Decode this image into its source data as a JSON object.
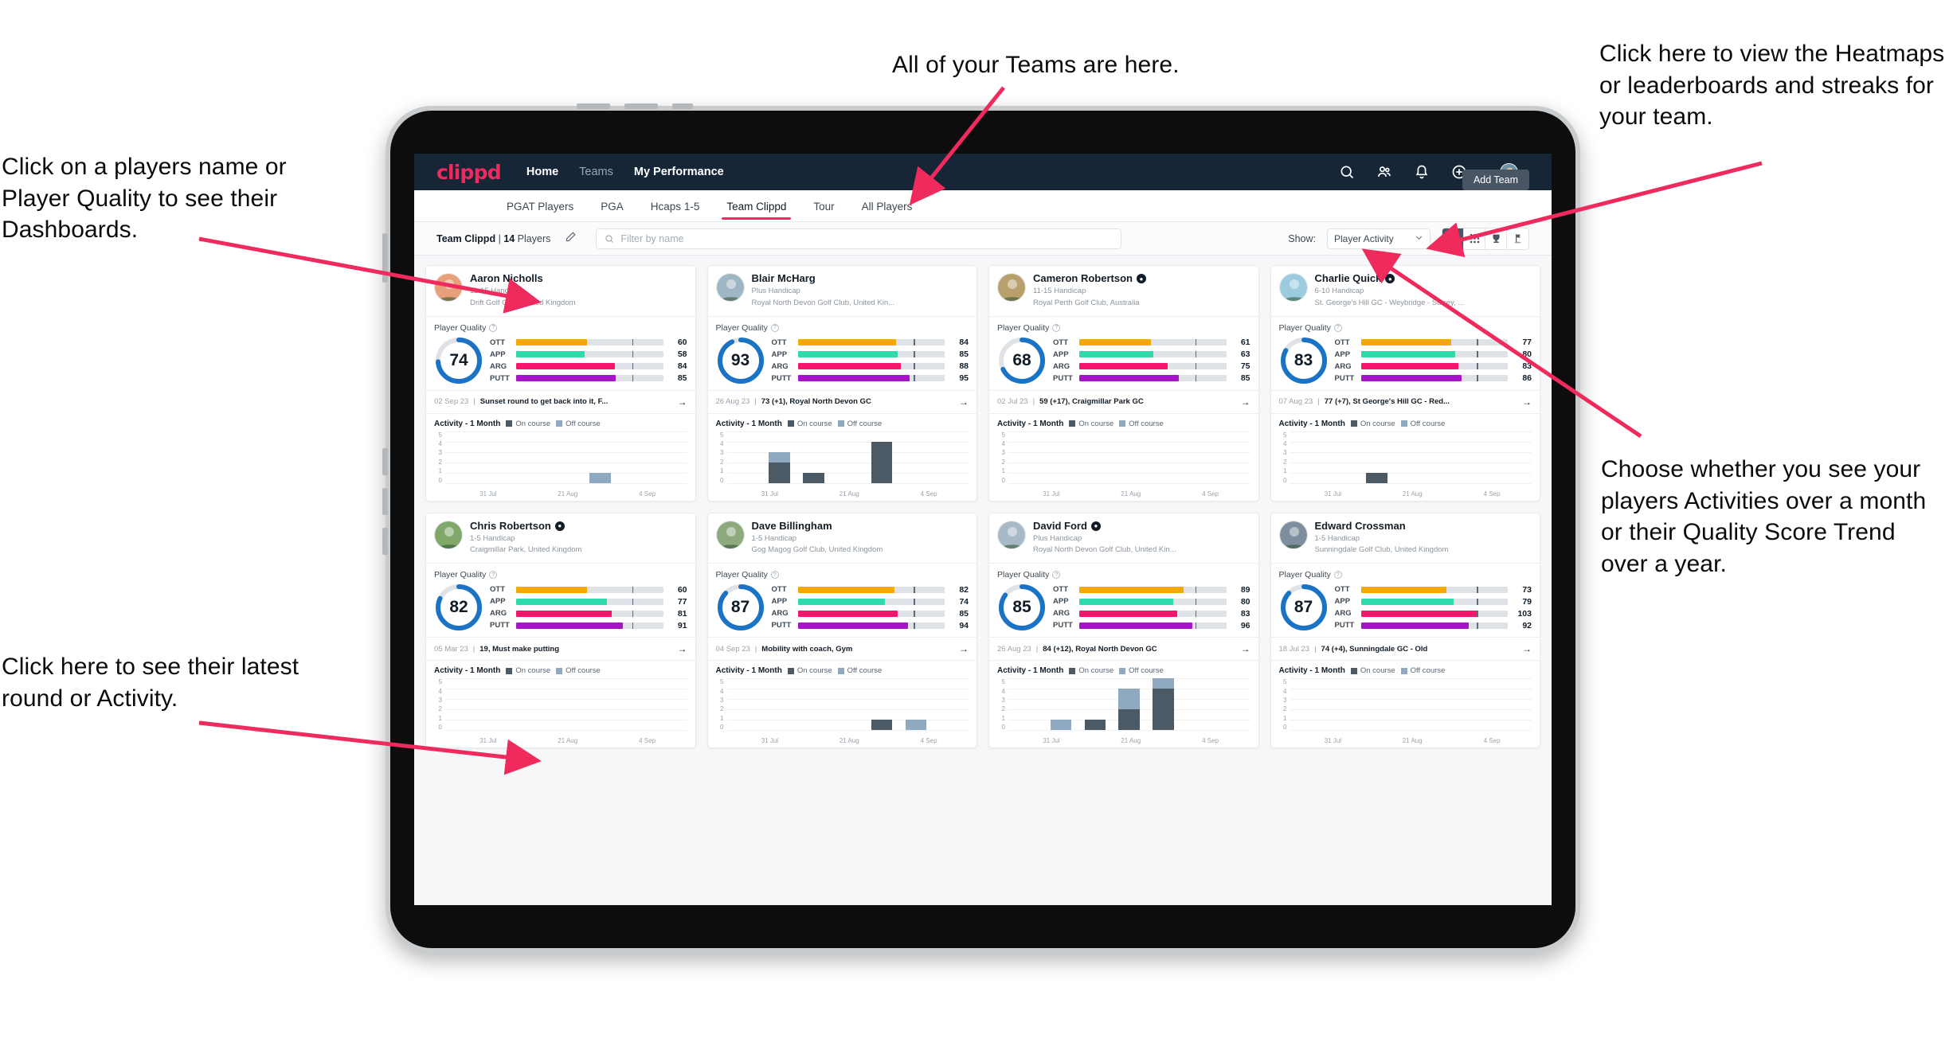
{
  "annotations": [
    {
      "id": "players-name",
      "text": "Click on a players name or Player Quality to see their Dashboards."
    },
    {
      "id": "teams",
      "text": "All of your Teams are here."
    },
    {
      "id": "heatmaps",
      "text": "Click here to view the Heatmaps or leaderboards and streaks for your team."
    },
    {
      "id": "activity-toggle",
      "text": "Choose whether you see your players Activities over a month or their Quality Score Trend over a year."
    },
    {
      "id": "latest-round",
      "text": "Click here to see their latest round or Activity."
    }
  ],
  "navbar": {
    "brand": "clippd",
    "links": [
      {
        "label": "Home",
        "active": true
      },
      {
        "label": "Teams",
        "active": false
      },
      {
        "label": "My Performance",
        "active": true
      }
    ],
    "icons": [
      "search-icon",
      "people-icon",
      "bell-icon",
      "plus-circle-icon",
      "avatar"
    ]
  },
  "tabs": {
    "items": [
      {
        "label": "PGAT Players",
        "active": false
      },
      {
        "label": "PGA",
        "active": false
      },
      {
        "label": "Hcaps 1-5",
        "active": false
      },
      {
        "label": "Team Clippd",
        "active": true
      },
      {
        "label": "Tour",
        "active": false
      },
      {
        "label": "All Players",
        "active": false
      }
    ],
    "add_team_label": "Add Team"
  },
  "filterbar": {
    "team_name": "Team Clippd",
    "separator": " | ",
    "player_count": "14",
    "players_word": " Players",
    "search_placeholder": "Filter by name",
    "show_label": "Show:",
    "show_value": "Player Activity",
    "views": [
      {
        "name": "grid-view-icon",
        "active": true
      },
      {
        "name": "dots-grid-view-icon",
        "active": false
      },
      {
        "name": "trophy-view-icon",
        "active": false
      },
      {
        "name": "flag-view-icon",
        "active": false
      }
    ]
  },
  "card_labels": {
    "player_quality": "Player Quality",
    "activity_title": "Activity - 1 Month",
    "legend_on": "On course",
    "legend_off": "Off course",
    "y_ticks": [
      "5",
      "4",
      "3",
      "2",
      "1",
      "0"
    ],
    "x_ticks": [
      "31 Jul",
      "21 Aug",
      "4 Sep"
    ]
  },
  "colors": {
    "accent": "#ef2a5c",
    "navbar": "#162637",
    "ring": "#1a73c4",
    "ott": "#f5a800",
    "app": "#2ed9ab",
    "arg": "#f5156c",
    "putt": "#a813c9",
    "on_course": "#4c5a66",
    "off_course": "#8fa9c0"
  },
  "players": [
    {
      "name": "Aaron Nicholls",
      "verified": false,
      "handicap": "11-15 Handicap",
      "club": "Drift Golf Club, United Kingdom",
      "quality": 74,
      "metrics": [
        {
          "key": "OTT",
          "value": 60
        },
        {
          "key": "APP",
          "value": 58
        },
        {
          "key": "ARG",
          "value": 84
        },
        {
          "key": "PUTT",
          "value": 85
        }
      ],
      "last_date": "02 Sep 23",
      "last_text": "Sunset round to get back into it, F...",
      "activity": [
        {
          "on": 0,
          "off": 0
        },
        {
          "on": 0,
          "off": 0
        },
        {
          "on": 0,
          "off": 0
        },
        {
          "on": 0,
          "off": 0
        },
        {
          "on": 0,
          "off": 1
        },
        {
          "on": 0,
          "off": 0
        },
        {
          "on": 0,
          "off": 0
        }
      ]
    },
    {
      "name": "Blair McHarg",
      "verified": false,
      "handicap": "Plus Handicap",
      "club": "Royal North Devon Golf Club, United Kin...",
      "quality": 93,
      "metrics": [
        {
          "key": "OTT",
          "value": 84
        },
        {
          "key": "APP",
          "value": 85
        },
        {
          "key": "ARG",
          "value": 88
        },
        {
          "key": "PUTT",
          "value": 95
        }
      ],
      "last_date": "26 Aug 23",
      "last_text": "73 (+1), Royal North Devon GC",
      "activity": [
        {
          "on": 0,
          "off": 0
        },
        {
          "on": 2,
          "off": 1
        },
        {
          "on": 1,
          "off": 0
        },
        {
          "on": 0,
          "off": 0
        },
        {
          "on": 4,
          "off": 0
        },
        {
          "on": 0,
          "off": 0
        },
        {
          "on": 0,
          "off": 0
        }
      ]
    },
    {
      "name": "Cameron Robertson",
      "verified": true,
      "handicap": "11-15 Handicap",
      "club": "Royal Perth Golf Club, Australia",
      "quality": 68,
      "metrics": [
        {
          "key": "OTT",
          "value": 61
        },
        {
          "key": "APP",
          "value": 63
        },
        {
          "key": "ARG",
          "value": 75
        },
        {
          "key": "PUTT",
          "value": 85
        }
      ],
      "last_date": "02 Jul 23",
      "last_text": "59 (+17), Craigmillar Park GC",
      "activity": [
        {
          "on": 0,
          "off": 0
        },
        {
          "on": 0,
          "off": 0
        },
        {
          "on": 0,
          "off": 0
        },
        {
          "on": 0,
          "off": 0
        },
        {
          "on": 0,
          "off": 0
        },
        {
          "on": 0,
          "off": 0
        },
        {
          "on": 0,
          "off": 0
        }
      ]
    },
    {
      "name": "Charlie Quick",
      "verified": true,
      "handicap": "6-10 Handicap",
      "club": "St. George's Hill GC - Weybridge - Surrey, ...",
      "quality": 83,
      "metrics": [
        {
          "key": "OTT",
          "value": 77
        },
        {
          "key": "APP",
          "value": 80
        },
        {
          "key": "ARG",
          "value": 83
        },
        {
          "key": "PUTT",
          "value": 86
        }
      ],
      "last_date": "07 Aug 23",
      "last_text": "77 (+7), St George's Hill GC - Red...",
      "activity": [
        {
          "on": 0,
          "off": 0
        },
        {
          "on": 0,
          "off": 0
        },
        {
          "on": 1,
          "off": 0
        },
        {
          "on": 0,
          "off": 0
        },
        {
          "on": 0,
          "off": 0
        },
        {
          "on": 0,
          "off": 0
        },
        {
          "on": 0,
          "off": 0
        }
      ]
    },
    {
      "name": "Chris Robertson",
      "verified": true,
      "handicap": "1-5 Handicap",
      "club": "Craigmillar Park, United Kingdom",
      "quality": 82,
      "metrics": [
        {
          "key": "OTT",
          "value": 60
        },
        {
          "key": "APP",
          "value": 77
        },
        {
          "key": "ARG",
          "value": 81
        },
        {
          "key": "PUTT",
          "value": 91
        }
      ],
      "last_date": "05 Mar 23",
      "last_text": "19, Must make putting",
      "activity": [
        {
          "on": 0,
          "off": 0
        },
        {
          "on": 0,
          "off": 0
        },
        {
          "on": 0,
          "off": 0
        },
        {
          "on": 0,
          "off": 0
        },
        {
          "on": 0,
          "off": 0
        },
        {
          "on": 0,
          "off": 0
        },
        {
          "on": 0,
          "off": 0
        }
      ]
    },
    {
      "name": "Dave Billingham",
      "verified": false,
      "handicap": "1-5 Handicap",
      "club": "Gog Magog Golf Club, United Kingdom",
      "quality": 87,
      "metrics": [
        {
          "key": "OTT",
          "value": 82
        },
        {
          "key": "APP",
          "value": 74
        },
        {
          "key": "ARG",
          "value": 85
        },
        {
          "key": "PUTT",
          "value": 94
        }
      ],
      "last_date": "04 Sep 23",
      "last_text": "Mobility with coach, Gym",
      "activity": [
        {
          "on": 0,
          "off": 0
        },
        {
          "on": 0,
          "off": 0
        },
        {
          "on": 0,
          "off": 0
        },
        {
          "on": 0,
          "off": 0
        },
        {
          "on": 1,
          "off": 0
        },
        {
          "on": 0,
          "off": 1
        },
        {
          "on": 0,
          "off": 0
        }
      ]
    },
    {
      "name": "David Ford",
      "verified": true,
      "handicap": "Plus Handicap",
      "club": "Royal North Devon Golf Club, United Kin...",
      "quality": 85,
      "metrics": [
        {
          "key": "OTT",
          "value": 89
        },
        {
          "key": "APP",
          "value": 80
        },
        {
          "key": "ARG",
          "value": 83
        },
        {
          "key": "PUTT",
          "value": 96
        }
      ],
      "last_date": "26 Aug 23",
      "last_text": "84 (+12), Royal North Devon GC",
      "activity": [
        {
          "on": 0,
          "off": 0
        },
        {
          "on": 0,
          "off": 1
        },
        {
          "on": 1,
          "off": 0
        },
        {
          "on": 2,
          "off": 2
        },
        {
          "on": 4,
          "off": 1
        },
        {
          "on": 0,
          "off": 0
        },
        {
          "on": 0,
          "off": 0
        }
      ]
    },
    {
      "name": "Edward Crossman",
      "verified": false,
      "handicap": "1-5 Handicap",
      "club": "Sunningdale Golf Club, United Kingdom",
      "quality": 87,
      "metrics": [
        {
          "key": "OTT",
          "value": 73
        },
        {
          "key": "APP",
          "value": 79
        },
        {
          "key": "ARG",
          "value": 103
        },
        {
          "key": "PUTT",
          "value": 92
        }
      ],
      "last_date": "18 Jul 23",
      "last_text": "74 (+4), Sunningdale GC - Old",
      "activity": [
        {
          "on": 0,
          "off": 0
        },
        {
          "on": 0,
          "off": 0
        },
        {
          "on": 0,
          "off": 0
        },
        {
          "on": 0,
          "off": 0
        },
        {
          "on": 0,
          "off": 0
        },
        {
          "on": 0,
          "off": 0
        },
        {
          "on": 0,
          "off": 0
        }
      ]
    }
  ]
}
